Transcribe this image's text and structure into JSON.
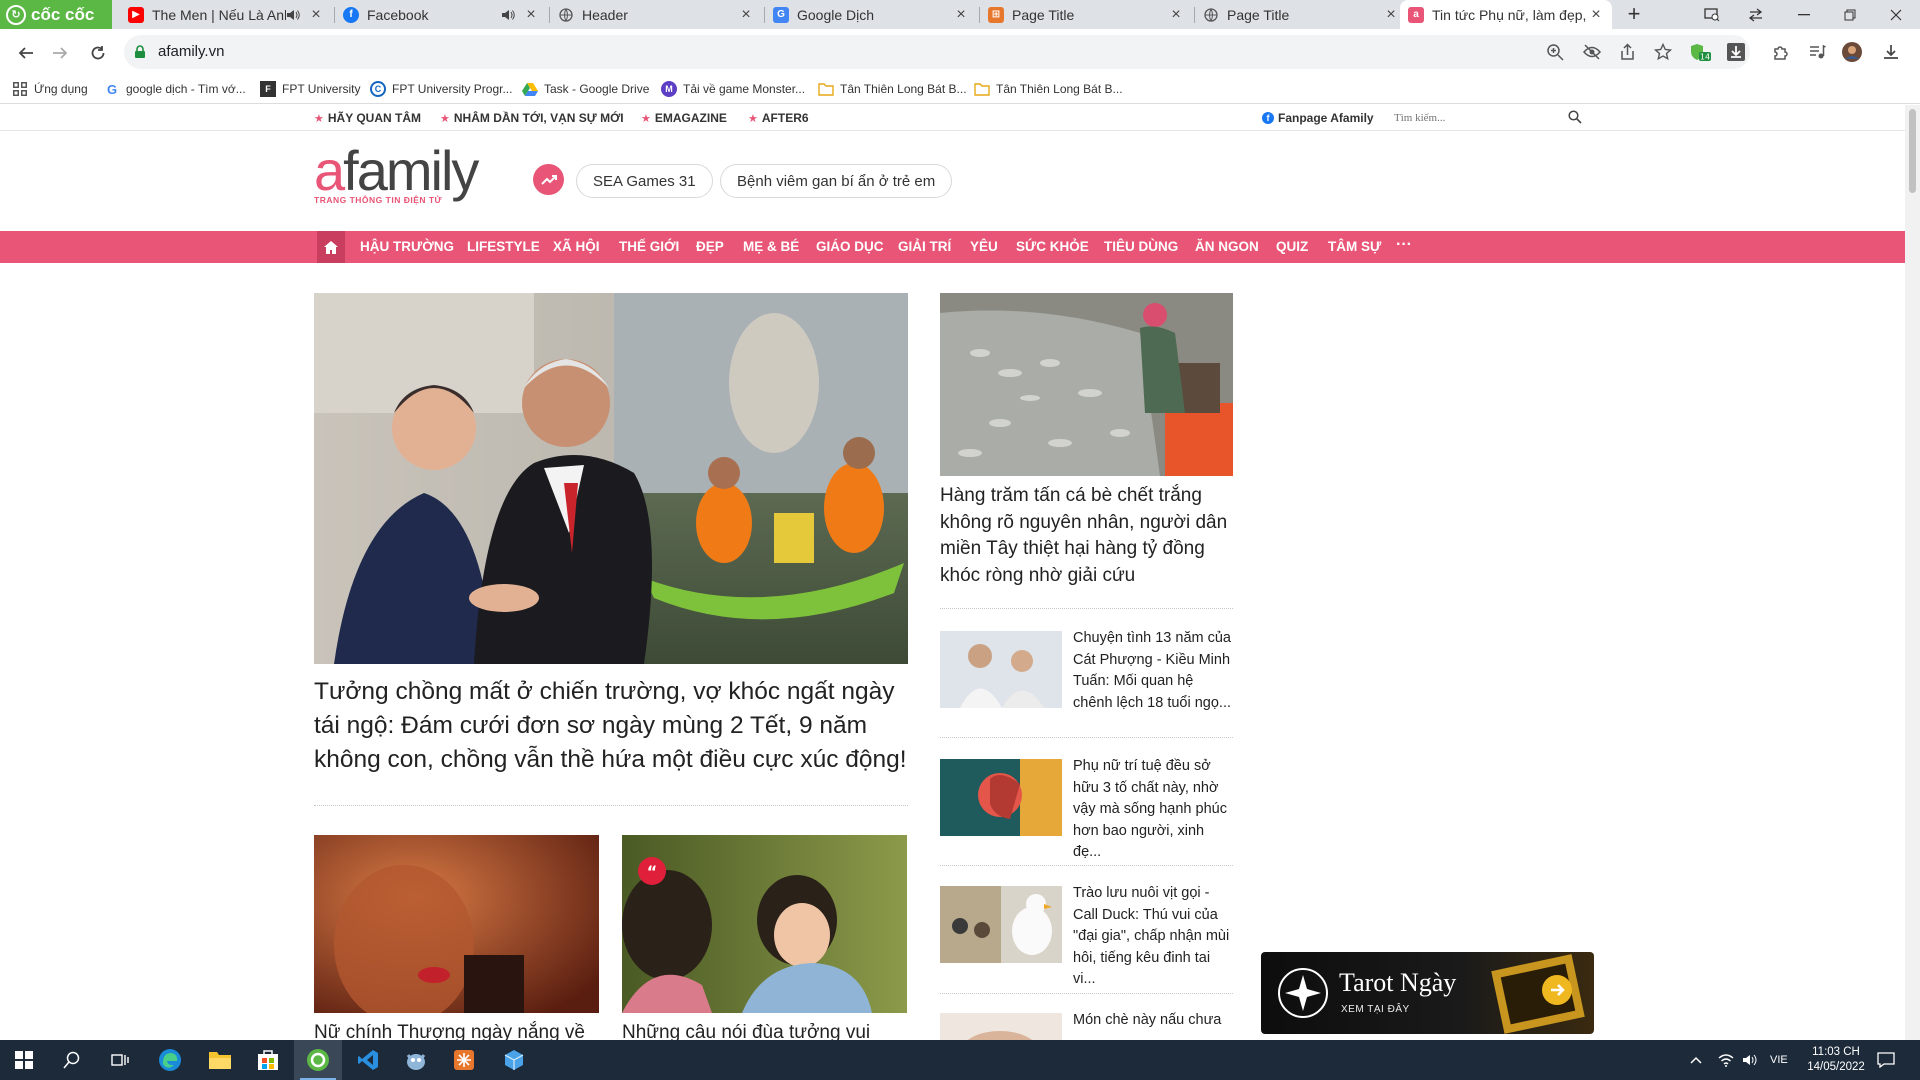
{
  "browser": {
    "brand": "cốc cốc",
    "tabs": [
      {
        "title": "The Men | Nếu Là Anh",
        "icon": "youtube-icon",
        "has_audio": true
      },
      {
        "title": "Facebook",
        "icon": "facebook-icon",
        "has_audio": true
      },
      {
        "title": "Header",
        "icon": "globe-icon",
        "has_audio": false
      },
      {
        "title": "Google Dịch",
        "icon": "google-translate-icon",
        "has_audio": false
      },
      {
        "title": "Page Title",
        "icon": "html-icon",
        "has_audio": false
      },
      {
        "title": "Page Title",
        "icon": "globe-icon",
        "has_audio": false
      },
      {
        "title": "Tin tức Phụ nữ, làm đẹp,",
        "icon": "afamily-icon",
        "has_audio": false,
        "active": true
      }
    ],
    "address_url": "afamily.vn",
    "extension_badge": "14",
    "bookmarks": [
      {
        "label": "Ứng dụng",
        "icon": "apps-grid-icon"
      },
      {
        "label": "google dịch - Tìm vớ...",
        "icon": "google-icon"
      },
      {
        "label": "FPT University",
        "icon": "fpt-icon"
      },
      {
        "label": "FPT University Progr...",
        "icon": "fpt-program-icon"
      },
      {
        "label": "Task - Google Drive",
        "icon": "google-drive-icon"
      },
      {
        "label": "Tải về game Monster...",
        "icon": "game-icon"
      },
      {
        "label": "Tân Thiên Long Bát B...",
        "icon": "folder-icon"
      },
      {
        "label": "Tân Thiên Long Bát B...",
        "icon": "folder-icon"
      }
    ]
  },
  "site": {
    "top_links": [
      "HÃY QUAN TÂM",
      "NHÂM DẦN TỚI, VẠN SỰ MỚI",
      "EMAGAZINE",
      "AFTER6"
    ],
    "fanpage": "Fanpage Afamily",
    "search_placeholder": "Tìm kiếm...",
    "logo_a": "a",
    "logo_rest": "family",
    "logo_tagline": "TRANG THÔNG TIN ĐIỆN TỬ",
    "trending": [
      "SEA Games 31",
      "Bệnh viêm gan bí ẩn ở trẻ em"
    ],
    "nav": [
      "HẬU TRƯỜNG",
      "LIFESTYLE",
      "XÃ HỘI",
      "THẾ GIỚI",
      "ĐẸP",
      "MẸ & BÉ",
      "GIÁO DỤC",
      "GIẢI TRÍ",
      "YÊU",
      "SỨC KHỎE",
      "TIÊU DÙNG",
      "ĂN NGON",
      "QUIZ",
      "TÂM SỰ",
      "···"
    ],
    "accent_color": "#e85576"
  },
  "articles": {
    "hero_title": "Tưởng chồng mất ở chiến trường, vợ khóc ngất ngày tái ngộ: Đám cưới đơn sơ ngày mùng 2 Tết, 9 năm không con, chồng vẫn thề hứa một điều cực xúc động!",
    "sub": [
      {
        "title": "Nữ chính Thượng ngày nắng về"
      },
      {
        "title": "Những câu nói đùa tưởng vui"
      }
    ],
    "side_main": "Hàng trăm tấn cá bè chết trắng không rõ nguyên nhân, người dân miền Tây thiệt hại hàng tỷ đồng khóc ròng nhờ giải cứu",
    "side_list": [
      "Chuyện tình 13 năm của Cát Phượng - Kiều Minh Tuấn: Mối quan hệ chênh lệch 18 tuổi ngọ...",
      "Phụ nữ trí tuệ đều sở hữu 3 tố chất này, nhờ vậy mà sống hạnh phúc hơn bao người, xinh đẹ...",
      "Trào lưu nuôi vịt gọi - Call Duck: Thú vui của \"đại gia\", chấp nhận mùi hôi, tiếng kêu đinh tai vi...",
      "Món chè này nấu chưa"
    ],
    "ad_title": "Tarot Ngày",
    "ad_sub": "XEM TẠI ĐÂY"
  },
  "taskbar": {
    "lang": "VIE",
    "time": "11:03 CH",
    "date": "14/05/2022"
  }
}
